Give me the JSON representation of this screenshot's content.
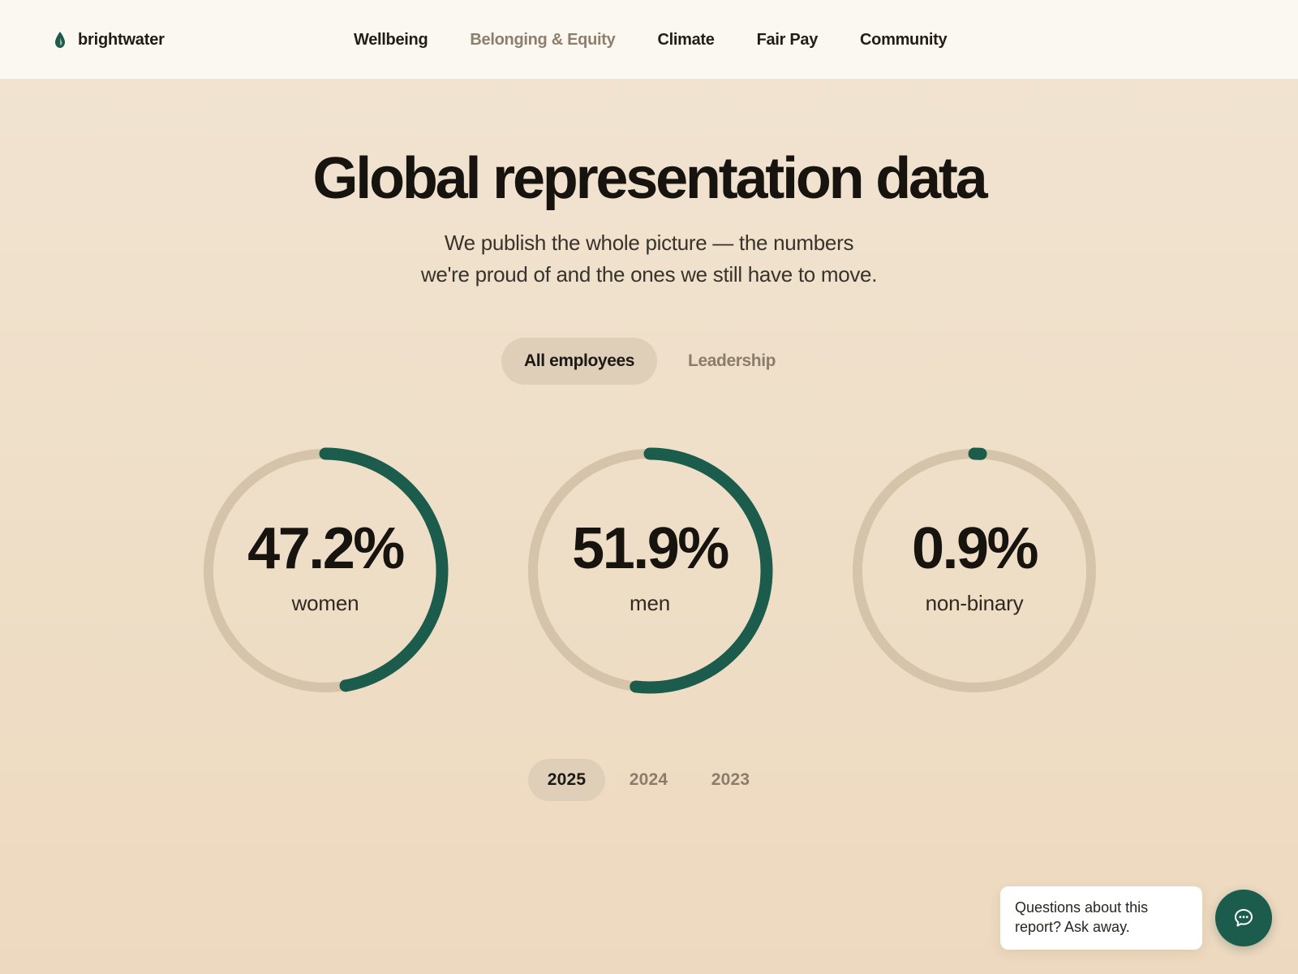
{
  "brand": {
    "name": "brightwater",
    "icon": "drop-icon"
  },
  "nav": [
    {
      "label": "Wellbeing",
      "active": false
    },
    {
      "label": "Belonging & Equity",
      "active": true
    },
    {
      "label": "Climate",
      "active": false
    },
    {
      "label": "Fair Pay",
      "active": false
    },
    {
      "label": "Community",
      "active": false
    }
  ],
  "hero": {
    "title": "Global representation data",
    "subtitle_line1": "We publish the whole picture — the numbers",
    "subtitle_line2": "we're proud of and the ones we still have to move."
  },
  "segment": [
    {
      "label": "All employees",
      "active": true
    },
    {
      "label": "Leadership",
      "active": false
    }
  ],
  "stats": [
    {
      "value": "47.2%",
      "label": "women",
      "fraction": 0.472
    },
    {
      "value": "51.9%",
      "label": "men",
      "fraction": 0.519
    },
    {
      "value": "0.9%",
      "label": "non-binary",
      "fraction": 0.009
    }
  ],
  "years": [
    {
      "label": "2025",
      "active": true
    },
    {
      "label": "2024",
      "active": false
    },
    {
      "label": "2023",
      "active": false
    }
  ],
  "chat": {
    "prompt": "Questions about this report? Ask away.",
    "icon": "chat-icon"
  },
  "colors": {
    "accent": "#1c5c4c",
    "ring_track": "#d6c4aa",
    "pill_active": "#dfcfb8",
    "muted_text": "#8c7d6b"
  }
}
